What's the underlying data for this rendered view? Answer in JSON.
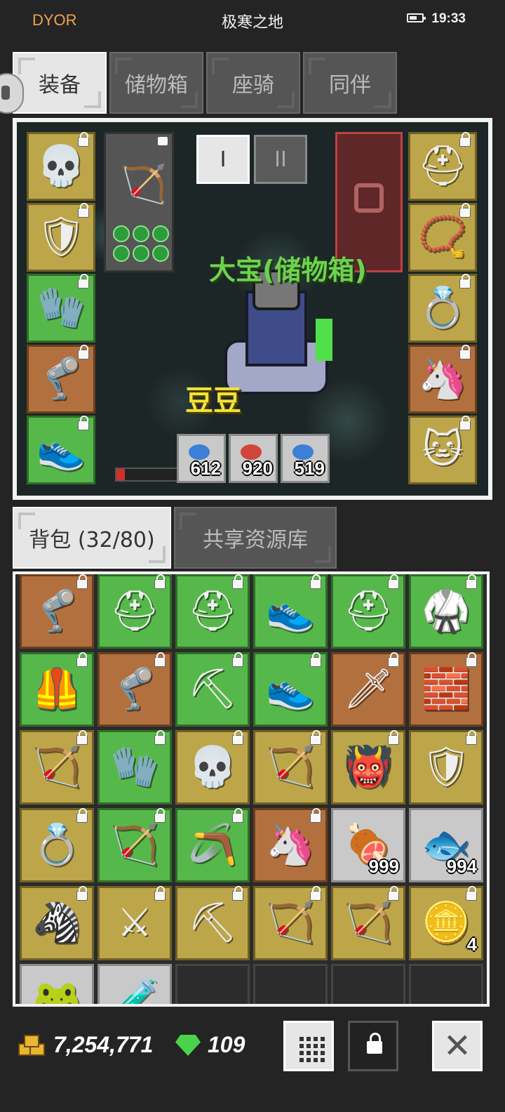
{
  "status": {
    "carrier": "DYOR",
    "title": "极寒之地",
    "time": "19:33"
  },
  "top_tabs": [
    "装备",
    "储物箱",
    "座骑",
    "同伴"
  ],
  "scene": {
    "weapon_tabs": [
      "I",
      "II"
    ],
    "pet_name": "大宝(储物箱)",
    "character_name": "豆豆",
    "potions": [
      {
        "color": "#3b7fd6",
        "count": "612"
      },
      {
        "color": "#d0463a",
        "count": "920"
      },
      {
        "color": "#3b7fd6",
        "count": "519"
      }
    ],
    "hp_fraction": 0.12,
    "left_slots": [
      {
        "icon": "💀",
        "name": "skull-helmet-icon",
        "color": "gold"
      },
      {
        "icon": "🛡",
        "name": "armor-icon",
        "color": "gold"
      },
      {
        "icon": "🧤",
        "name": "gloves-icon",
        "color": "green"
      },
      {
        "icon": "🦿",
        "name": "leg-armor-icon",
        "color": "orange"
      },
      {
        "icon": "👟",
        "name": "boots-icon",
        "color": "green"
      }
    ],
    "weapon_icon": "🏹",
    "right_slots": [
      {
        "icon": "⛑",
        "name": "horned-helmet-icon",
        "color": "gold"
      },
      {
        "icon": "📿",
        "name": "necklace-icon",
        "color": "gold"
      },
      {
        "icon": "💍",
        "name": "ring-icon",
        "color": "gold"
      },
      {
        "icon": "🦄",
        "name": "unicorn-card-icon",
        "color": "orange"
      },
      {
        "icon": "🐱",
        "name": "cat-card-icon",
        "color": "gold"
      }
    ]
  },
  "bag_tabs": [
    "背包 (32/80)",
    "共享资源库"
  ],
  "bag_items": [
    {
      "icon": "🦿",
      "name": "leg-armor-icon",
      "color": "orange",
      "count": ""
    },
    {
      "icon": "⛑",
      "name": "horned-helmet-icon",
      "color": "green",
      "count": ""
    },
    {
      "icon": "⛑",
      "name": "horned-helmet-icon",
      "color": "green",
      "count": ""
    },
    {
      "icon": "👟",
      "name": "boots-icon",
      "color": "green",
      "count": ""
    },
    {
      "icon": "⛑",
      "name": "horned-helmet-icon",
      "color": "green",
      "count": ""
    },
    {
      "icon": "🥋",
      "name": "chest-armor-icon",
      "color": "green",
      "count": ""
    },
    {
      "icon": "🦺",
      "name": "red-armor-icon",
      "color": "green",
      "count": ""
    },
    {
      "icon": "🦿",
      "name": "leg-armor-icon",
      "color": "orange",
      "count": ""
    },
    {
      "icon": "⛏",
      "name": "pickaxe-icon",
      "color": "green",
      "count": ""
    },
    {
      "icon": "👟",
      "name": "boots-icon",
      "color": "green",
      "count": ""
    },
    {
      "icon": "🗡",
      "name": "dagger-icon",
      "color": "orange",
      "count": ""
    },
    {
      "icon": "🧱",
      "name": "red-vest-icon",
      "color": "orange",
      "count": ""
    },
    {
      "icon": "🏹",
      "name": "bow-icon",
      "color": "gold",
      "count": ""
    },
    {
      "icon": "🧤",
      "name": "gauntlet-icon",
      "color": "green",
      "count": ""
    },
    {
      "icon": "💀",
      "name": "skull-helmet-icon",
      "color": "gold",
      "count": ""
    },
    {
      "icon": "🏹",
      "name": "crossbow-icon",
      "color": "gold",
      "count": ""
    },
    {
      "icon": "👹",
      "name": "demon-helmet-icon",
      "color": "gold",
      "count": ""
    },
    {
      "icon": "🛡",
      "name": "red-shield-icon",
      "color": "gold",
      "count": ""
    },
    {
      "icon": "💍",
      "name": "ring-icon",
      "color": "gold",
      "count": ""
    },
    {
      "icon": "🏹",
      "name": "bow-icon",
      "color": "green",
      "count": ""
    },
    {
      "icon": "🪃",
      "name": "scythe-icon",
      "color": "green",
      "count": ""
    },
    {
      "icon": "🦄",
      "name": "unicorn-card-icon",
      "color": "orange",
      "count": ""
    },
    {
      "icon": "🍖",
      "name": "meat-icon",
      "color": "silver",
      "count": "999"
    },
    {
      "icon": "🐟",
      "name": "fish-icon",
      "color": "silver",
      "count": "994"
    },
    {
      "icon": "🦓",
      "name": "zebra-card-icon",
      "color": "gold",
      "count": ""
    },
    {
      "icon": "⚔",
      "name": "crossed-weapons-icon",
      "color": "gold",
      "count": ""
    },
    {
      "icon": "⛏",
      "name": "crossbow-icon",
      "color": "gold",
      "count": ""
    },
    {
      "icon": "🏹",
      "name": "crossbow-icon",
      "color": "gold",
      "count": ""
    },
    {
      "icon": "🏹",
      "name": "bow-icon",
      "color": "gold",
      "count": ""
    },
    {
      "icon": "🪙",
      "name": "gold-coin-icon",
      "color": "gold",
      "count": "4"
    },
    {
      "icon": "🐸",
      "name": "frog-icon",
      "color": "silver",
      "count": ""
    },
    {
      "icon": "🧪",
      "name": "potion-bottle-icon",
      "color": "silver",
      "count": ""
    },
    {
      "icon": "",
      "name": "empty-slot",
      "color": "dark",
      "count": ""
    },
    {
      "icon": "",
      "name": "empty-slot",
      "color": "dark",
      "count": ""
    },
    {
      "icon": "",
      "name": "empty-slot",
      "color": "dark",
      "count": ""
    },
    {
      "icon": "",
      "name": "empty-slot",
      "color": "dark",
      "count": ""
    }
  ],
  "currency": {
    "gold": "7,254,771",
    "gems": "109"
  }
}
